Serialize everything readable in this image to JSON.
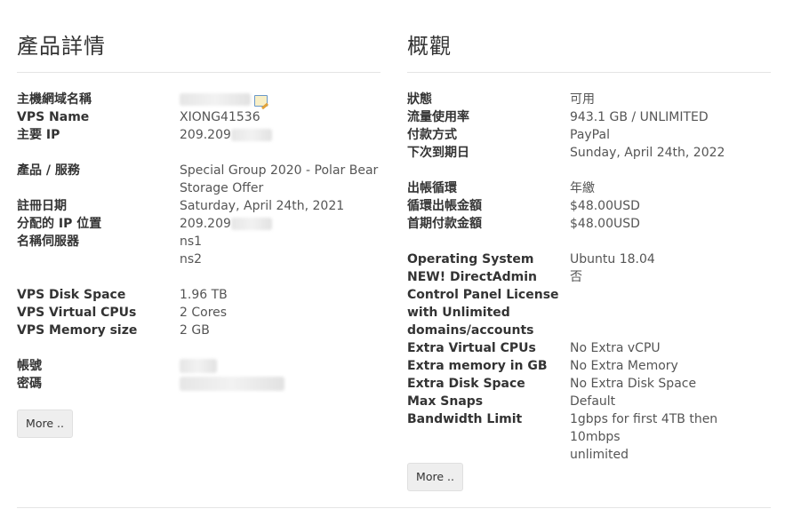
{
  "product": {
    "title": "產品詳情",
    "rows": [
      {
        "label": "主機網域名稱",
        "value": ""
      },
      {
        "label": "VPS Name",
        "value": "XIONG41536"
      },
      {
        "label": "主要 IP",
        "value": "209.209"
      },
      {
        "label": "產品 / 服務",
        "value": "Special Group 2020 - Polar Bear",
        "value2": "Storage Offer"
      },
      {
        "label": "註冊日期",
        "value": "Saturday, April 24th, 2021"
      },
      {
        "label": "分配的 IP 位置",
        "value": "209.209"
      },
      {
        "label": "名稱伺服器",
        "value": "ns1",
        "value2": "ns2"
      },
      {
        "label": "VPS Disk Space",
        "value": "1.96 TB"
      },
      {
        "label": "VPS Virtual CPUs",
        "value": "2 Cores"
      },
      {
        "label": "VPS Memory size",
        "value": "2 GB"
      },
      {
        "label": "帳號",
        "value": ""
      },
      {
        "label": "密碼",
        "value": ""
      }
    ],
    "more_label": "More .."
  },
  "overview": {
    "title": "概觀",
    "rows": [
      {
        "label": "狀態",
        "value": "可用"
      },
      {
        "label": "流量使用率",
        "value": "943.1 GB / UNLIMITED"
      },
      {
        "label": "付款方式",
        "value": "PayPal"
      },
      {
        "label": "下次到期日",
        "value": "Sunday, April 24th, 2022"
      },
      {
        "label": "出帳循環",
        "value": "年繳"
      },
      {
        "label": "循環出帳金額",
        "value": "$48.00USD"
      },
      {
        "label": "首期付款金額",
        "value": "$48.00USD"
      },
      {
        "label": "Operating System",
        "value": "Ubuntu 18.04"
      },
      {
        "label": "NEW! DirectAdmin",
        "label2": "Control Panel License",
        "label3": "with Unlimited",
        "label4": "domains/accounts",
        "value": "否"
      },
      {
        "label": "Extra Virtual CPUs",
        "value": "No Extra vCPU"
      },
      {
        "label": "Extra memory in GB",
        "value": "No Extra Memory"
      },
      {
        "label": "Extra Disk Space",
        "value": "No Extra Disk Space"
      },
      {
        "label": "Max Snaps",
        "value": "Default"
      },
      {
        "label": "Bandwidth Limit",
        "value": "1gbps for first 4TB then 10mbps",
        "value2": "unlimited"
      }
    ],
    "more_label": "More .."
  }
}
